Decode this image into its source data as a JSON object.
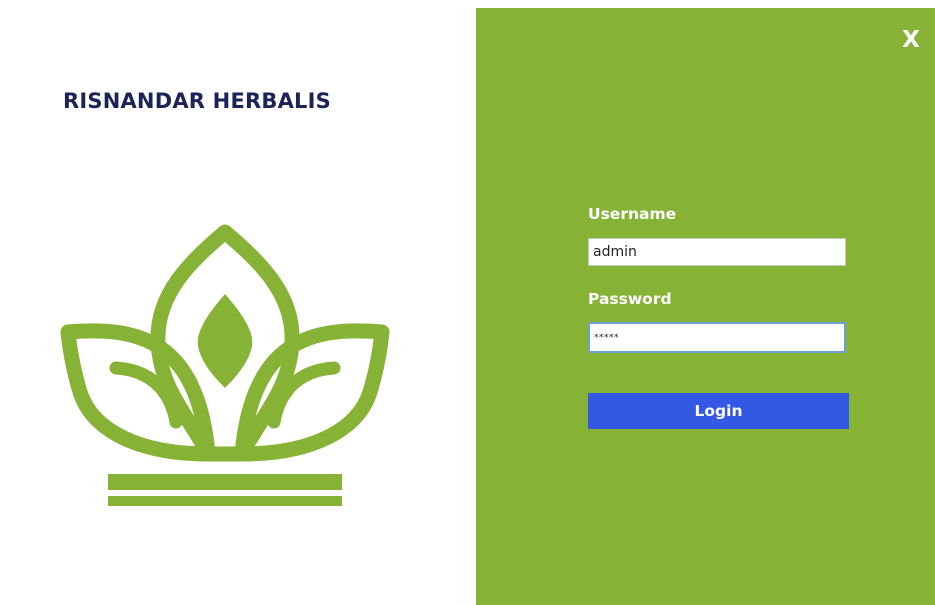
{
  "brand": {
    "name": "RISNANDAR HERBALIS",
    "logo_icon": "crown-leaf-logo-icon",
    "logo_color": "#86b336",
    "title_color": "#1b2358"
  },
  "panel": {
    "background": "#86b336",
    "close_label": "X"
  },
  "form": {
    "username_label": "Username",
    "username_value": "admin",
    "password_label": "Password",
    "password_value": "*****",
    "login_label": "Login",
    "login_color": "#3458e4"
  }
}
